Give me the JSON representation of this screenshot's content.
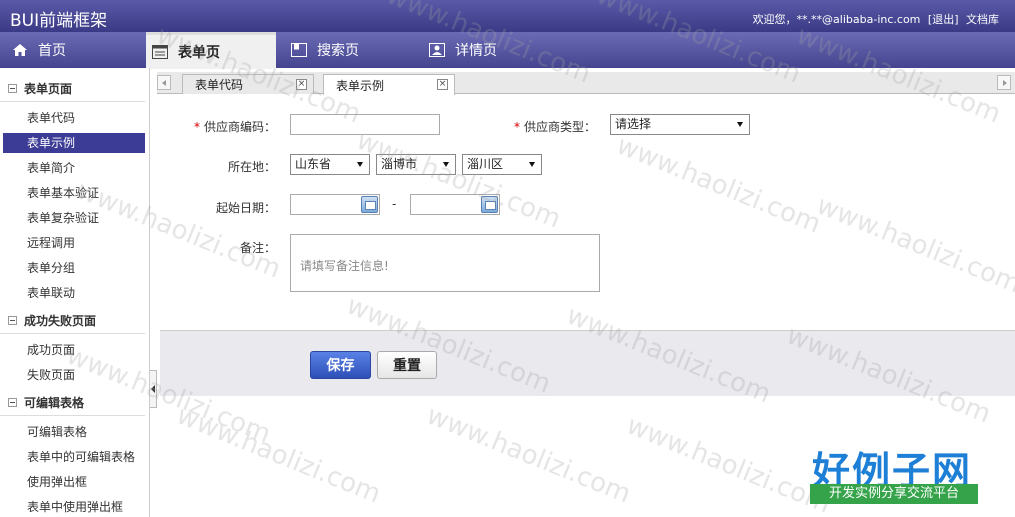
{
  "header": {
    "brand": "BUI前端框架",
    "welcome": "欢迎您，**.**@alibaba-inc.com",
    "logout": "[退出]",
    "docs": "文档库"
  },
  "nav": {
    "items": [
      {
        "label": "首页",
        "icon": "home-icon"
      },
      {
        "label": "表单页",
        "icon": "form-icon"
      },
      {
        "label": "搜索页",
        "icon": "search-page-icon"
      },
      {
        "label": "详情页",
        "icon": "detail-icon"
      }
    ],
    "active": "表单页"
  },
  "sidebar": {
    "groups": [
      {
        "title": "表单页面",
        "items": [
          "表单代码",
          "表单示例",
          "表单简介",
          "表单基本验证",
          "表单复杂验证",
          "远程调用",
          "表单分组",
          "表单联动"
        ]
      },
      {
        "title": "成功失败页面",
        "items": [
          "成功页面",
          "失败页面"
        ]
      },
      {
        "title": "可编辑表格",
        "items": [
          "可编辑表格",
          "表单中的可编辑表格",
          "使用弹出框",
          "表单中使用弹出框"
        ]
      }
    ],
    "selected": "表单示例"
  },
  "tabs": {
    "items": [
      {
        "label": "表单代码",
        "close": "×"
      },
      {
        "label": "表单示例",
        "close": "×"
      }
    ],
    "active": "表单示例"
  },
  "form": {
    "required_mark": "*",
    "supplier_code_label": "供应商编码：",
    "supplier_code_value": "",
    "supplier_type_label": "供应商类型：",
    "supplier_type_value": "请选择",
    "location_label": "所在地：",
    "province": "山东省",
    "city": "淄博市",
    "district": "淄川区",
    "date_label": "起始日期：",
    "date_start": "",
    "date_end": "",
    "date_separator": "-",
    "remark_label": "备注：",
    "remark_placeholder": "请填写备注信息!"
  },
  "actions": {
    "save": "保存",
    "reset": "重置"
  },
  "watermark": {
    "text": "www.haolizi.com",
    "logo_main": "好例子网",
    "logo_sub": "开发实例分享交流平台"
  },
  "colors": {
    "header_bg": "#3a3a86",
    "selected_item": "#3c3c96",
    "primary_button": "#2c4fb8",
    "required": "#cc0000",
    "logo_blue": "#1e7fd6",
    "logo_green": "#35a34a"
  }
}
